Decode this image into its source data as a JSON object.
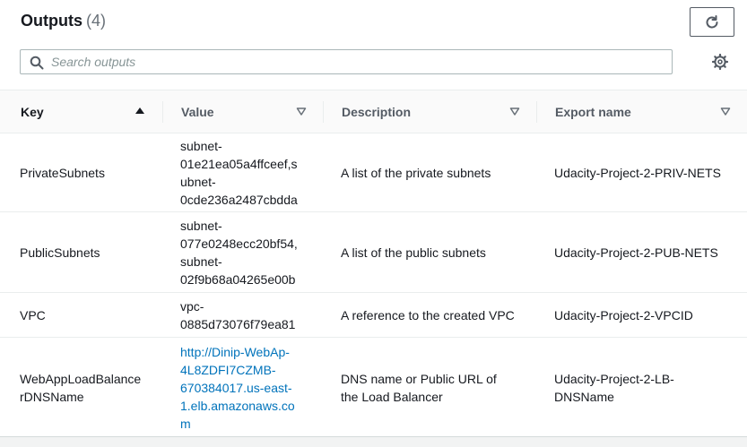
{
  "header": {
    "title": "Outputs",
    "count": "(4)",
    "refresh_icon": "refresh-icon",
    "settings_icon": "gear-icon"
  },
  "search": {
    "placeholder": "Search outputs",
    "value": ""
  },
  "table": {
    "columns": [
      {
        "label": "Key",
        "sort": "ascending"
      },
      {
        "label": "Value",
        "sort": "none"
      },
      {
        "label": "Description",
        "sort": "none"
      },
      {
        "label": "Export name",
        "sort": "none"
      }
    ],
    "rows": [
      {
        "key": "PrivateSubnets",
        "value_lines": [
          "subnet-",
          "01e21ea05a4ffceef,s",
          "ubnet-",
          "0cde236a2487cbdda"
        ],
        "description": "A list of the private subnets",
        "export": "Udacity-Project-2-PRIV-NETS"
      },
      {
        "key": "PublicSubnets",
        "value_lines": [
          "subnet-",
          "077e0248ecc20bf54,",
          "subnet-",
          "02f9b68a04265e00b"
        ],
        "description": "A list of the public subnets",
        "export": "Udacity-Project-2-PUB-NETS"
      },
      {
        "key": "VPC",
        "value_lines": [
          "vpc-",
          "0885d73076f79ea81"
        ],
        "description": "A reference to the created VPC",
        "export": "Udacity-Project-2-VPCID"
      },
      {
        "key_lines": [
          "WebAppLoadBalance",
          "rDNSName"
        ],
        "value_link_lines": [
          "http://Dinip-WebAp-",
          "4L8ZDFI7CZMB-",
          "670384017.us-east-",
          "1.elb.amazonaws.co",
          "m"
        ],
        "description_lines": [
          "DNS name or Public URL of",
          "the Load Balancer"
        ],
        "export_lines": [
          "Udacity-Project-2-LB-",
          "DNSName"
        ]
      }
    ]
  },
  "colors": {
    "link": "#0073bb",
    "header_bg": "#fafafa",
    "text": "#16191f",
    "muted": "#687078"
  }
}
